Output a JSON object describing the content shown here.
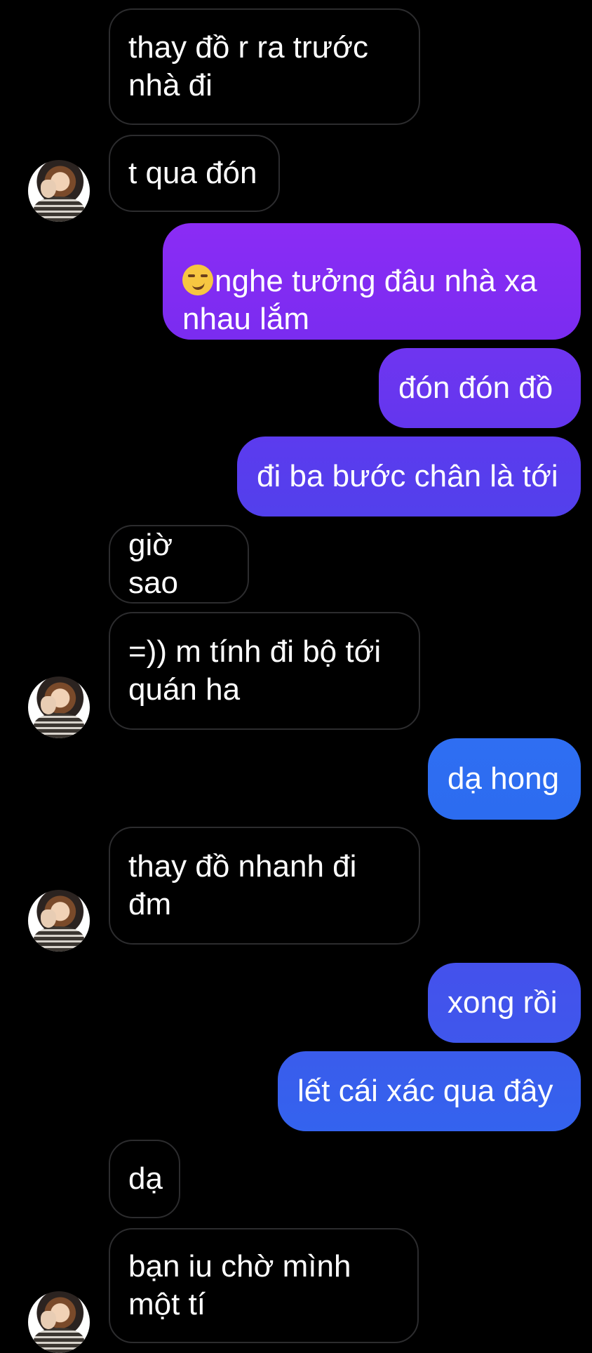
{
  "colors": {
    "background": "#000000",
    "received_border": "#2c2c2e",
    "sent_purple": "#8b2cf5",
    "sent_blue": "#2d6cf0",
    "text": "#ffffff"
  },
  "messages": [
    {
      "text": "thay đồ r ra trước\nnhà đi",
      "from": "other"
    },
    {
      "text": "t qua đón",
      "from": "other"
    },
    {
      "text": "nghe tưởng đâu nhà xa\nnhau lắm",
      "from": "me",
      "emoji": "smirking-face"
    },
    {
      "text": "đón đón đồ",
      "from": "me"
    },
    {
      "text": "đi ba bước chân là tới",
      "from": "me"
    },
    {
      "text": "giờ sao",
      "from": "other"
    },
    {
      "text": "=)) m tính đi bộ tới\nquán ha",
      "from": "other"
    },
    {
      "text": "dạ hong",
      "from": "me"
    },
    {
      "text": "thay đồ nhanh đi\nđm",
      "from": "other"
    },
    {
      "text": "xong rồi",
      "from": "me"
    },
    {
      "text": "lết cái xác qua đây",
      "from": "me"
    },
    {
      "text": "dạ",
      "from": "other"
    },
    {
      "text": "bạn iu chờ mình\nmột tí",
      "from": "other"
    }
  ]
}
